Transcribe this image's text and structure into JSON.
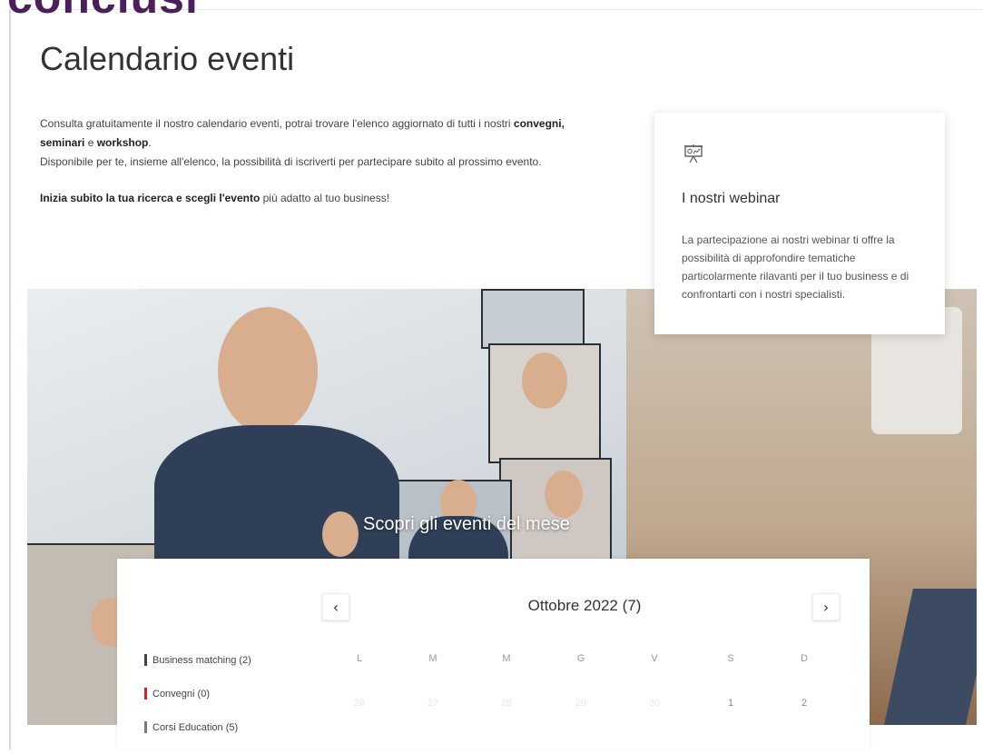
{
  "overlay_text": "conclusi",
  "page": {
    "title": "Calendario eventi",
    "intro_line1_a": "Consulta gratuitamente il nostro calendario eventi, potrai trovare l'elenco aggiornato di tutti i nostri ",
    "intro_line1_bold": "convegni, seminari",
    "intro_line1_b": " e ",
    "intro_line1_bold2": "workshop",
    "intro_line1_c": ".",
    "intro_line2": "Disponibile per te, insieme all'elenco, la possibilità di iscriverti per partecipare subito al prossimo evento.",
    "intro_line3_bold": "Inizia subito la tua ricerca e scegli l'evento",
    "intro_line3_rest": " più adatto al tuo business!"
  },
  "webinar_card": {
    "icon": "presentation-board-icon",
    "title": "I nostri webinar",
    "description": "La partecipazione ai nostri webinar ti offre la possibilità di approfondire tematiche particolarmente rilavanti per il tuo business e di confrontarti con i nostri specialisti."
  },
  "hero": {
    "caption": "Scopri gli eventi del mese"
  },
  "calendar": {
    "prev_icon": "‹",
    "next_icon": "›",
    "month_label": "Ottobre 2022 (7)",
    "categories": [
      {
        "label": "Business matching (2)",
        "color": "#444444"
      },
      {
        "label": "Convegni (0)",
        "color": "#e02020"
      },
      {
        "label": "Corsi Education (5)",
        "color": "#777777"
      }
    ],
    "weekdays": [
      "L",
      "M",
      "M",
      "G",
      "V",
      "S",
      "D"
    ],
    "first_row": [
      "26",
      "27",
      "28",
      "29",
      "30",
      "1",
      "2"
    ]
  }
}
